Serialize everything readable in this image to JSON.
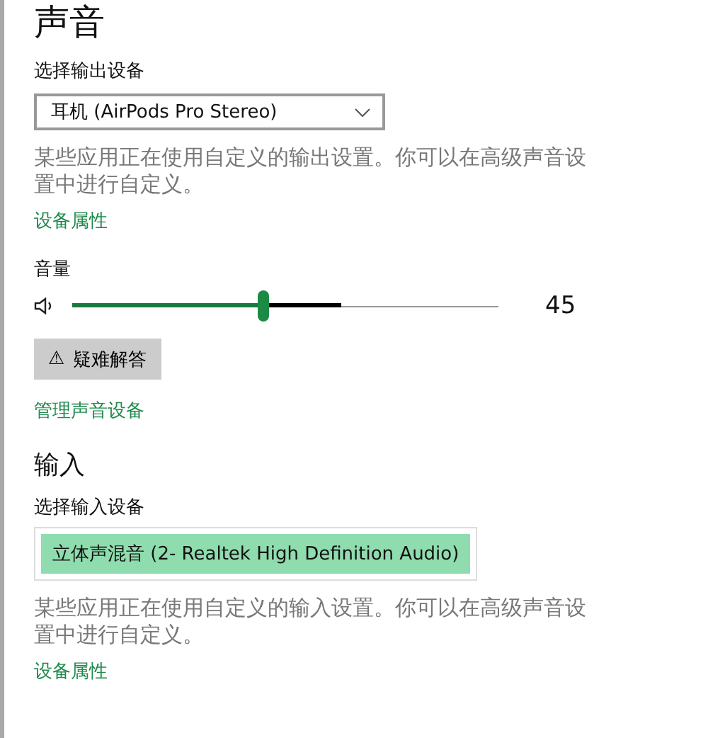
{
  "title": "声音",
  "output": {
    "label": "选择输出设备",
    "device": "耳机 (AirPods Pro Stereo)",
    "note": "某些应用正在使用自定义的输出设置。你可以在高级声音设置中进行自定义。",
    "link": "设备属性"
  },
  "volume": {
    "label": "音量",
    "level": 0.45,
    "meter": {
      "level": 0.63
    },
    "reading": "45"
  },
  "troubleshoot": {
    "label": "疑难解答",
    "icon": "⚠"
  },
  "manage_link": "管理声音设备",
  "input": {
    "heading": "输入",
    "label": "选择输入设备",
    "device": "立体声混音 (2- Realtek High Definition Audio)",
    "selected": true,
    "note": "某些应用正在使用自定义的输入设置。你可以在高级声音设置中进行自定义。",
    "link": "设备属性"
  }
}
